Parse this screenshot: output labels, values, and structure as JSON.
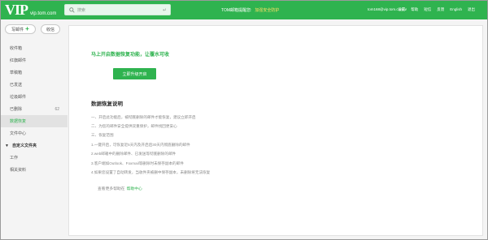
{
  "header": {
    "logo_mark": "VIP",
    "logo_domain": "vip.tom.com",
    "search_placeholder": "搜索",
    "notice_text": "TOM邮箱提醒您:",
    "notice_warn": "加强安全防护",
    "account": "tom168@vip.tom.com ∨",
    "links": [
      "设置",
      "帮助",
      "短信",
      "反馈",
      "English",
      "退出"
    ],
    "bg_color": "#2fb34f"
  },
  "sidebar": {
    "compose_label": "写邮件",
    "receive_label": "收信",
    "items": [
      {
        "label": "收件箱",
        "count": ""
      },
      {
        "label": "红旗邮件",
        "count": ""
      },
      {
        "label": "草稿箱",
        "count": ""
      },
      {
        "label": "已发送",
        "count": ""
      },
      {
        "label": "垃圾邮件",
        "count": ""
      },
      {
        "label": "已删除",
        "count": "62"
      },
      {
        "label": "数据恢复",
        "count": "",
        "active": true
      },
      {
        "label": "文件中心",
        "count": ""
      }
    ],
    "section_title": "自定义文件夹",
    "folders": [
      "工作",
      "相关资料"
    ]
  },
  "main": {
    "promo": "马上开启数据恢复功能，让覆水可收",
    "cta_label": "立即升级开启",
    "desc_title": "数据恢复说明",
    "lines": [
      "一、开启此功能后，被彻底删除的邮件才能恢复，建议立即开启",
      "二、为您的邮件安全提供双重保护，邮件找回更安心",
      "三、恢复范围",
      "1.一键开启，可恢复近5天内及开启后30天内彻底删除的邮件",
      "2.web邮箱中的删除邮件、已发送等彻底删除的邮件",
      "3.客户端如Outlook、Foxmail等删除时未保存副本的邮件",
      "4.如果您设置了自动转发，当收件夹被删中保存副本，未删除将无法恢复"
    ],
    "more_text": "查看更多帮助在",
    "more_link": "帮助中心"
  }
}
